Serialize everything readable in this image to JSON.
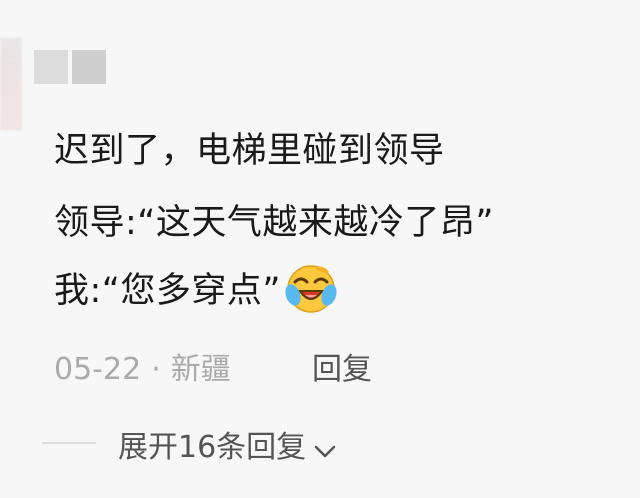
{
  "comment": {
    "lines": [
      "迟到了，电梯里碰到领导",
      "领导:“这天气越来越冷了昂”",
      "我:“您多穿点”"
    ],
    "emoji_icon": "laughing-crying-emoji"
  },
  "meta": {
    "date": "05-22",
    "separator": "·",
    "location": "新疆",
    "reply_label": "回复"
  },
  "replies": {
    "expand_label": "展开16条回复",
    "chevron_icon": "chevron-down-icon"
  },
  "colors": {
    "text": "#1a1a1a",
    "meta": "#aaaaaa",
    "action": "#555555",
    "emoji_face": "#ffc83d"
  }
}
